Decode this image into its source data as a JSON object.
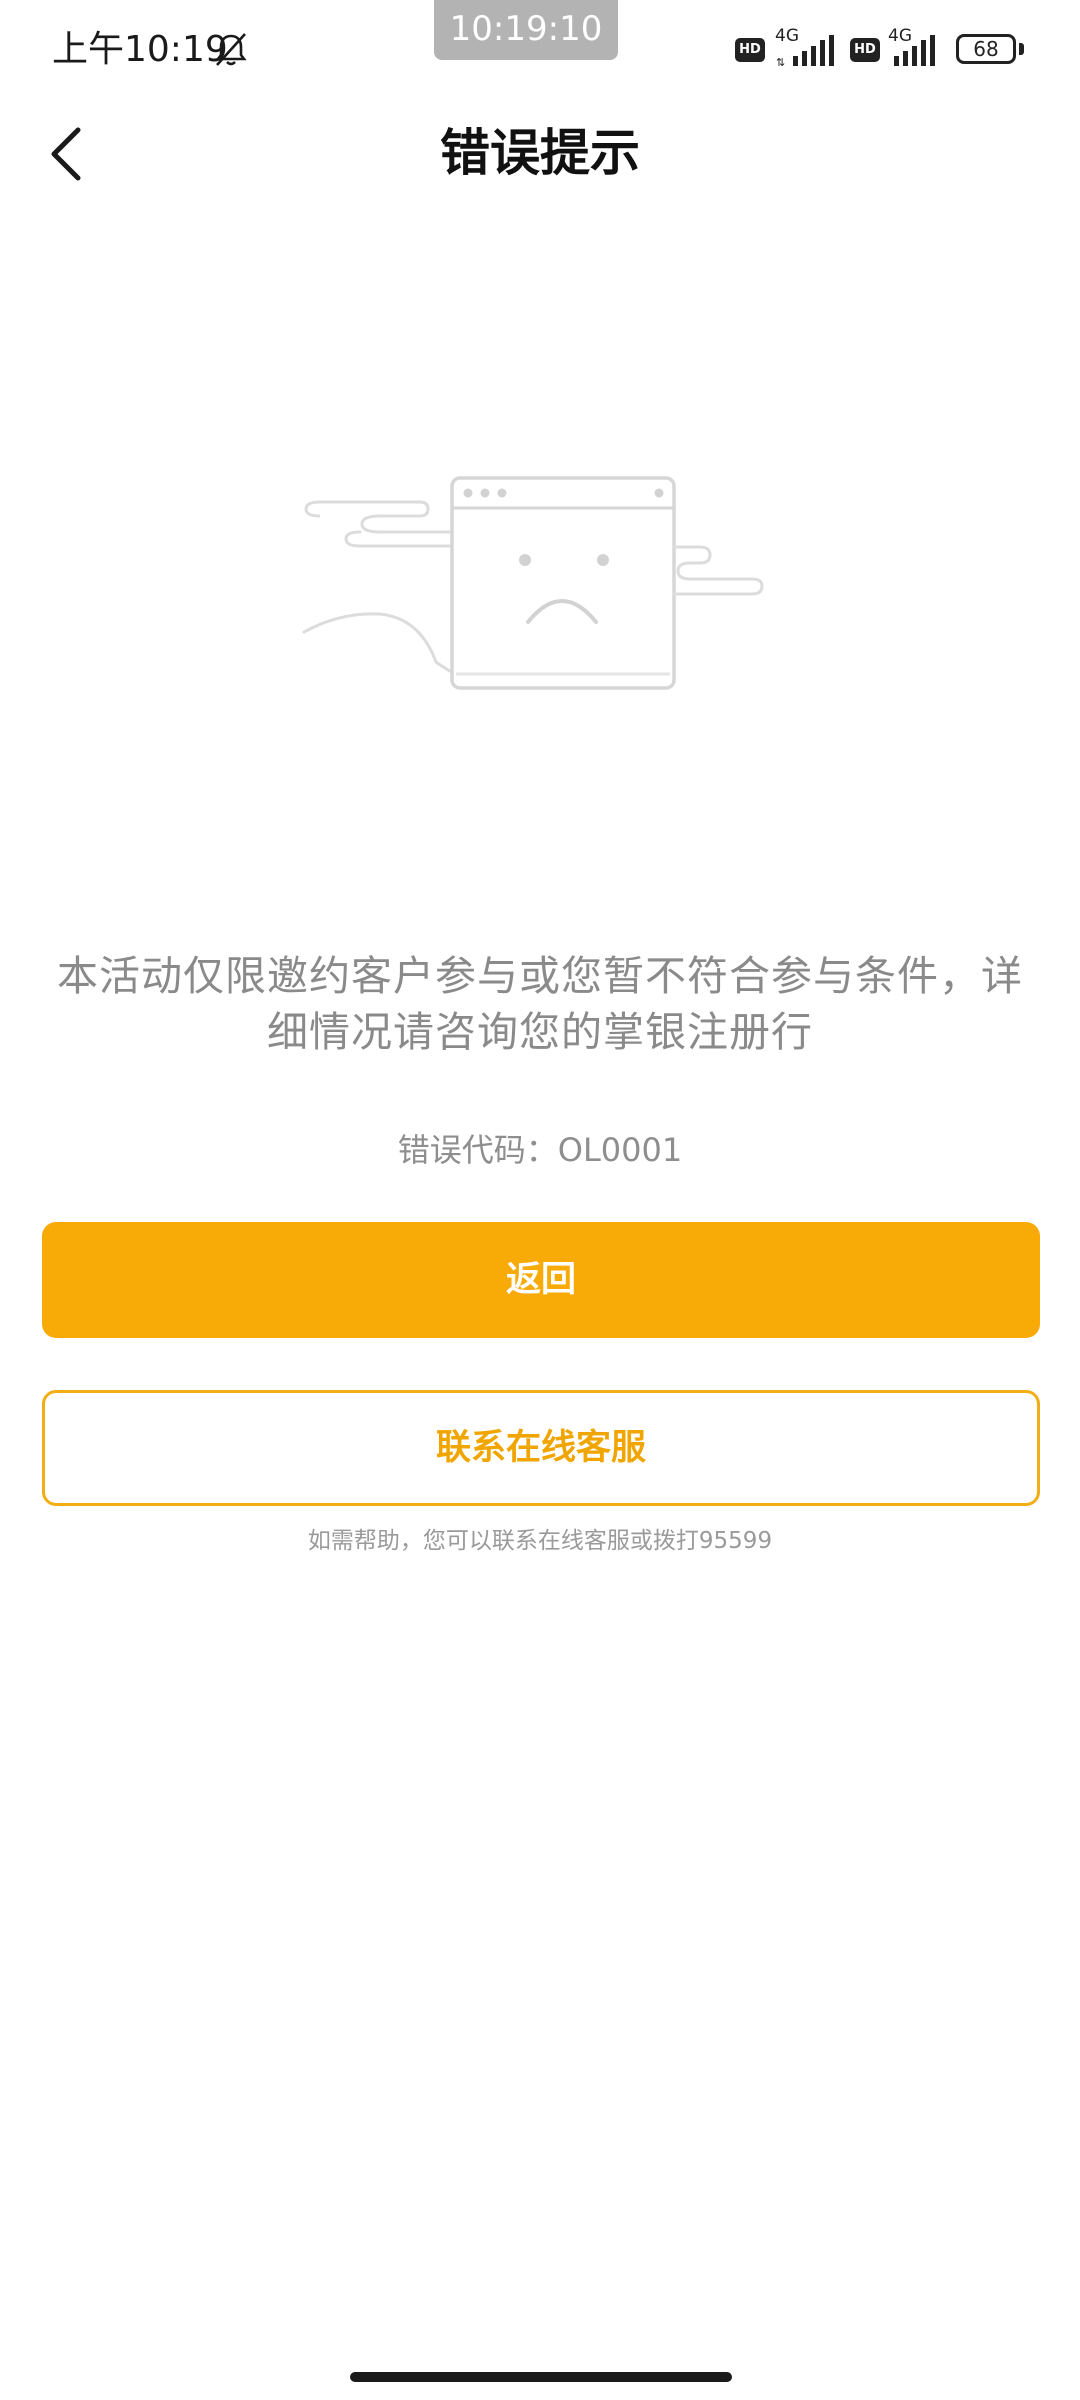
{
  "status_bar": {
    "time": "上午10:19",
    "clock_overlay": "10:19:10",
    "sim1": {
      "hd": "HD",
      "network": "4G"
    },
    "sim2": {
      "hd": "HD",
      "network": "4G"
    },
    "battery": "68",
    "icons": [
      "bell-off-icon",
      "signal-icon",
      "battery-icon"
    ]
  },
  "header": {
    "title": "错误提示",
    "back_icon": "chevron-left-icon"
  },
  "main": {
    "illustration_icon": "sad-browser-window-icon",
    "message": "本活动仅限邀约客户参与或您暂不符合参与条件，详细情况请咨询您的掌银注册行",
    "error_code": "错误代码：OL0001",
    "primary_button": "返回",
    "secondary_button": "联系在线客服",
    "help_text": "如需帮助，您可以联系在线客服或拨打95599"
  },
  "colors": {
    "accent": "#f8aa07",
    "accent_text": "#f0a500",
    "muted_text": "#8a8a8a"
  }
}
